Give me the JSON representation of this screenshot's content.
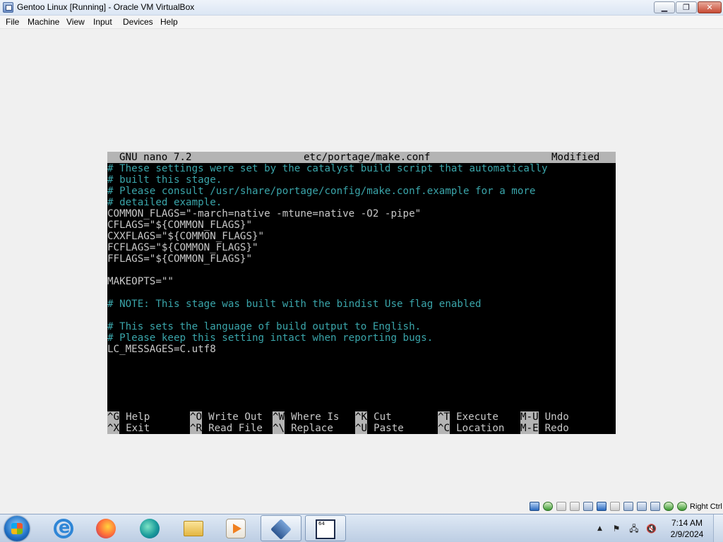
{
  "window": {
    "title": "Gentoo Linux [Running] - Oracle VM VirtualBox",
    "minimize": "▁",
    "maximize": "❐",
    "close": "✕"
  },
  "menu": {
    "file": "File",
    "machine": "Machine",
    "view": "View",
    "input": "Input",
    "devices": "Devices",
    "help": "Help"
  },
  "nano": {
    "app": "GNU nano 7.2",
    "file": "etc/portage/make.conf",
    "state": "Modified",
    "lines": [
      {
        "text": "# These settings were set by the catalyst build script that automatically",
        "kind": "comment"
      },
      {
        "text": "# built this stage.",
        "kind": "comment"
      },
      {
        "text": "# Please consult /usr/share/portage/config/make.conf.example for a more",
        "kind": "comment"
      },
      {
        "text": "# detailed example.",
        "kind": "comment"
      },
      {
        "text": "COMMON_FLAGS=\"-march=native -mtune=native -O2 -pipe\"",
        "kind": "code"
      },
      {
        "text": "CFLAGS=\"${COMMON_FLAGS}\"",
        "kind": "code"
      },
      {
        "text": "CXXFLAGS=\"${COMMON_FLAGS}\"",
        "kind": "code"
      },
      {
        "text": "FCFLAGS=\"${COMMON_FLAGS}\"",
        "kind": "code"
      },
      {
        "text": "FFLAGS=\"${COMMON_FLAGS}\"",
        "kind": "code"
      },
      {
        "text": "",
        "kind": "code"
      },
      {
        "text": "MAKEOPTS=\"\"",
        "kind": "code"
      },
      {
        "text": "",
        "kind": "code"
      },
      {
        "text": "# NOTE: This stage was built with the bindist Use flag enabled",
        "kind": "comment"
      },
      {
        "text": "",
        "kind": "code"
      },
      {
        "text": "# This sets the language of build output to English.",
        "kind": "comment"
      },
      {
        "text": "# Please keep this setting intact when reporting bugs.",
        "kind": "comment"
      },
      {
        "text": "LC_MESSAGES=C.utf8",
        "kind": "code"
      }
    ],
    "shortcuts_row1": [
      {
        "key": "^G",
        "label": "Help"
      },
      {
        "key": "^O",
        "label": "Write Out"
      },
      {
        "key": "^W",
        "label": "Where Is"
      },
      {
        "key": "^K",
        "label": "Cut"
      },
      {
        "key": "^T",
        "label": "Execute"
      },
      {
        "key": "M-U",
        "label": "Undo"
      }
    ],
    "shortcuts_row2": [
      {
        "key": "^X",
        "label": "Exit"
      },
      {
        "key": "^R",
        "label": "Read File"
      },
      {
        "key": "^\\",
        "label": "Replace"
      },
      {
        "key": "^U",
        "label": "Paste"
      },
      {
        "key": "^C",
        "label": "Location"
      },
      {
        "key": "M-E",
        "label": "Redo"
      }
    ]
  },
  "status_bar": {
    "host_key": "Right Ctrl",
    "icons": [
      "hard-disk-icon",
      "optical-drive-icon",
      "floppy-icon",
      "audio-icon",
      "network-icon",
      "usb-icon",
      "shared-folders-icon",
      "display-icon",
      "video-capture-icon",
      "cpu-icon",
      "arrow-icon",
      "keyboard-icon"
    ]
  },
  "taskbar": {
    "apps": [
      "internet-explorer-icon",
      "firefox-icon",
      "edge-icon",
      "file-explorer-icon",
      "media-player-icon",
      "virtualbox-icon",
      "virtualbox-vm-icon"
    ],
    "tray": {
      "show_hidden": "▲",
      "flag_icon": "⚑",
      "network_icon": "🖧",
      "volume_icon": "🔇"
    },
    "time": "7:14 AM",
    "date": "2/9/2024"
  },
  "colors": {
    "comment": "#3aa5aa",
    "code": "#c8c8c8",
    "header_bg": "#b4b4b4",
    "terminal_bg": "#000000"
  }
}
